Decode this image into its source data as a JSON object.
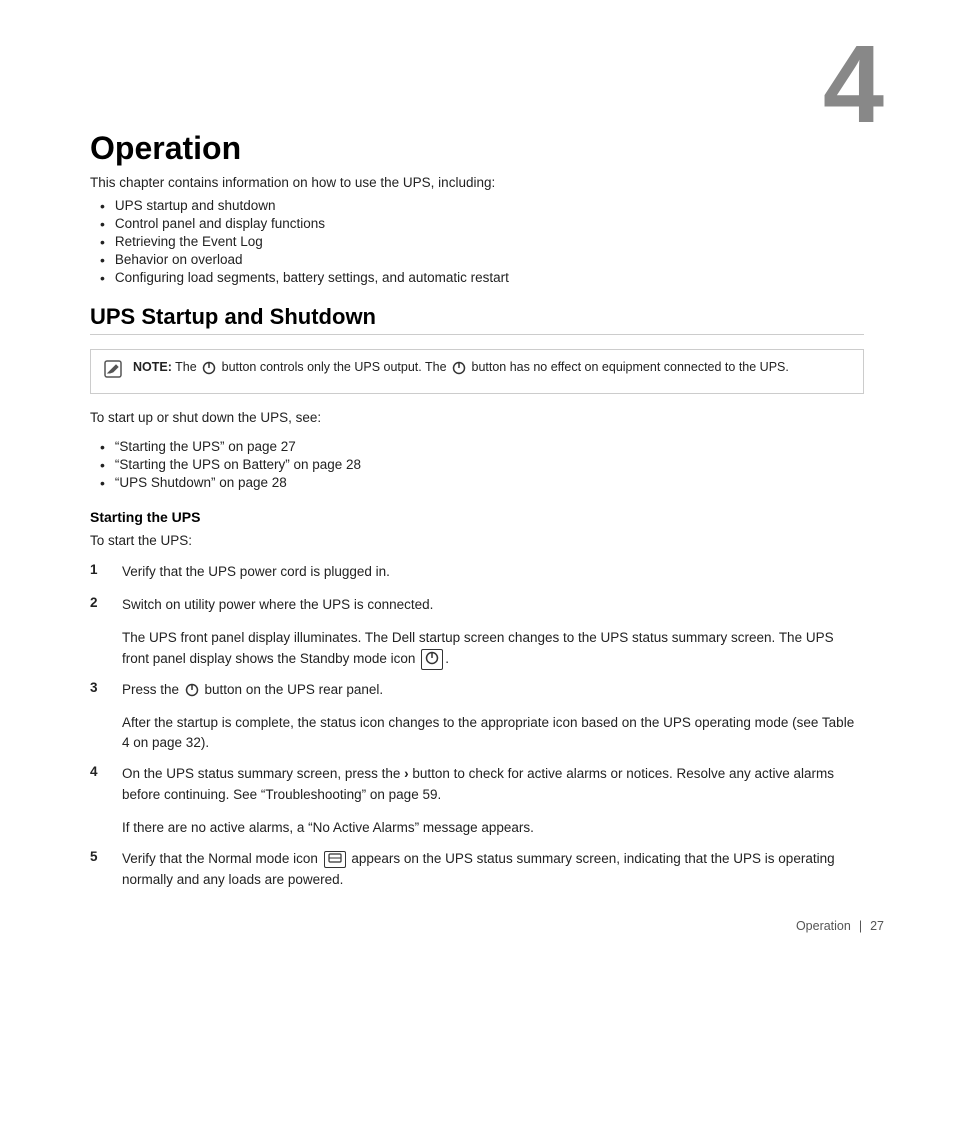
{
  "chapter": {
    "number": "4",
    "title": "Operation"
  },
  "intro": {
    "text": "This chapter contains information on how to use the UPS, including:"
  },
  "bullet_items": [
    "UPS startup and shutdown",
    "Control panel and display functions",
    "Retrieving the Event Log",
    "Behavior on overload",
    "Configuring load segments, battery settings, and automatic restart"
  ],
  "section1": {
    "title": "UPS Startup and Shutdown",
    "note": {
      "bold": "NOTE:",
      "text1": " The ",
      "text2": " button controls only the UPS output. The ",
      "text3": " button has no effect on equipment connected to the UPS."
    },
    "startup_intro": "To start up or shut down the UPS, see:",
    "startup_links": [
      "“Starting the UPS” on page 27",
      "“Starting the UPS on Battery” on page 28",
      "“UPS Shutdown” on page 28"
    ],
    "subsection": {
      "title": "Starting the UPS",
      "intro": "To start the UPS:",
      "steps": [
        {
          "num": "1",
          "text": "Verify that the UPS power cord is plugged in."
        },
        {
          "num": "2",
          "text": "Switch on utility power where the UPS is connected.",
          "sub": "The UPS front panel display illuminates. The Dell startup screen changes to the UPS status summary screen. The UPS front panel display shows the Standby mode icon □."
        },
        {
          "num": "3",
          "text": "Press the ⏻ button on the UPS rear panel.",
          "sub": "After the startup is complete, the status icon changes to the appropriate icon based on the UPS operating mode (see Table 4 on page 32)."
        },
        {
          "num": "4",
          "text": "On the UPS status summary screen, press the › button to check for active alarms or notices. Resolve any active alarms before continuing. See “Troubleshooting” on page 59.",
          "sub": "If there are no active alarms, a “No Active Alarms” message appears."
        },
        {
          "num": "5",
          "text": "Verify that the Normal mode icon ■ appears on the UPS status summary screen, indicating that the UPS is operating normally and any loads are powered."
        }
      ]
    }
  },
  "footer": {
    "label": "Operation",
    "sep": "|",
    "page": "27"
  }
}
